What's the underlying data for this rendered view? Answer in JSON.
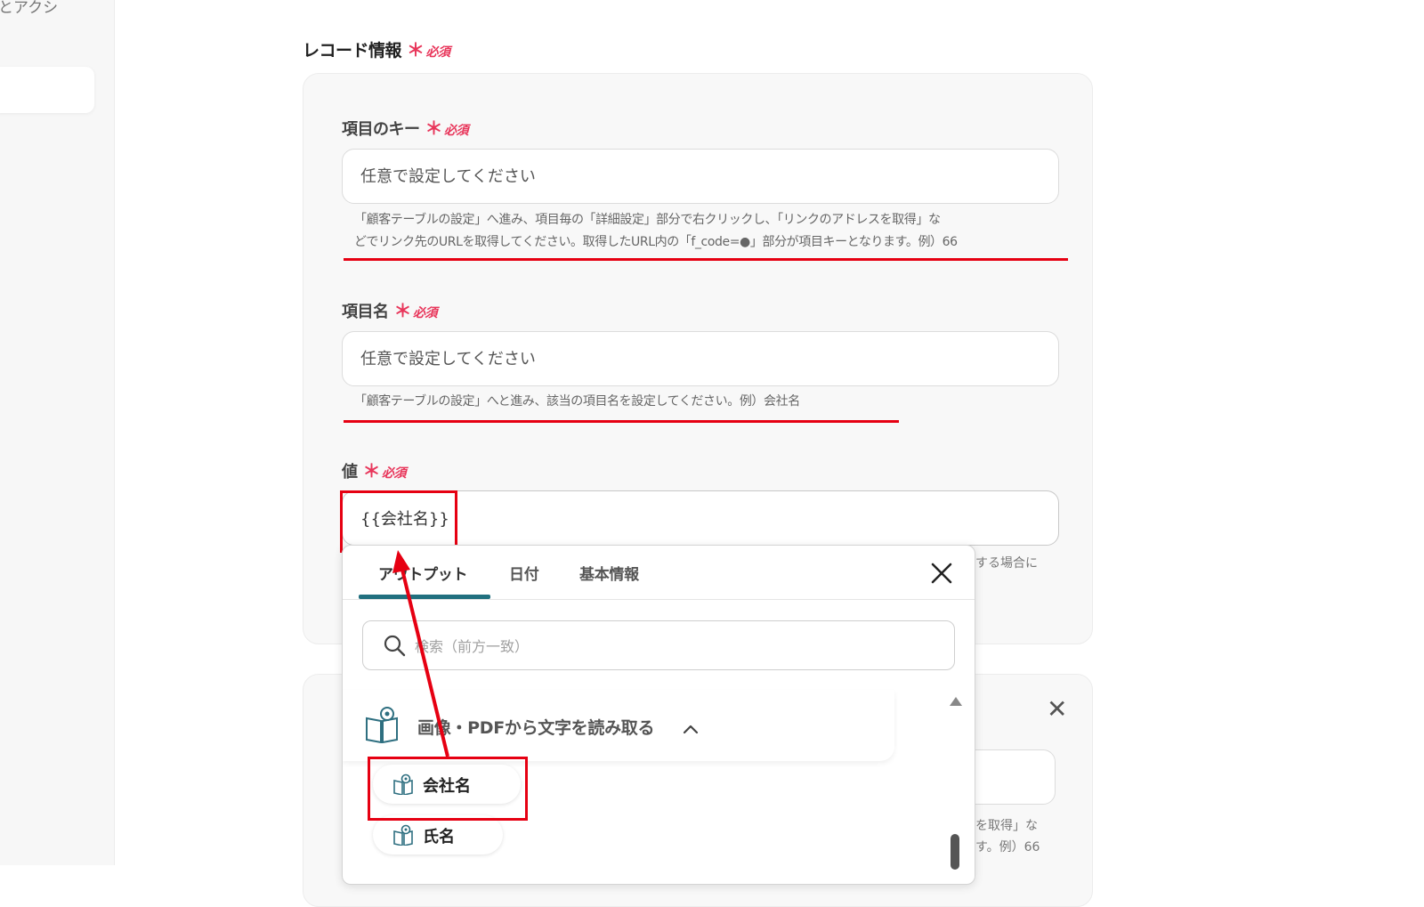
{
  "sidebar": {
    "partial_text": "とアクシ"
  },
  "section": {
    "title": "レコード情報"
  },
  "required": {
    "star": "＊",
    "label": "必須"
  },
  "fields": {
    "item_key": {
      "label": "項目のキー",
      "placeholder": "任意で設定してください",
      "help_line1": "「顧客テーブルの設定」へ進み、項目毎の「詳細設定」部分で右クリックし、「リンクのアドレスを取得」な",
      "help_line2": "どでリンク先のURLを取得してください。取得したURL内の「f_code=●」部分が項目キーとなります。例）66"
    },
    "item_name": {
      "label": "項目名",
      "placeholder": "任意で設定してください",
      "help": "「顧客テーブルの設定」へと進み、該当の項目名を設定してください。例）会社名"
    },
    "value": {
      "label": "値",
      "value": "{{会社名}}",
      "help_partial": "する場合に"
    }
  },
  "background_card2": {
    "help_partial_line1": "を取得」な",
    "help_partial_line2": "す。例）66",
    "close_symbol": "✕"
  },
  "popup": {
    "tabs": [
      {
        "label": "アウトプット",
        "active": true
      },
      {
        "label": "日付",
        "active": false
      },
      {
        "label": "基本情報",
        "active": false
      }
    ],
    "search_placeholder": "検索（前方一致）",
    "group": {
      "label": "画像・PDFから文字を読み取る",
      "expanded": true
    },
    "items": [
      {
        "label": "会社名",
        "highlighted": true
      },
      {
        "label": "氏名",
        "highlighted": false
      }
    ]
  },
  "colors": {
    "accent_teal": "#21707f",
    "required_red": "#e8355a",
    "annotation_red": "#e60012"
  }
}
